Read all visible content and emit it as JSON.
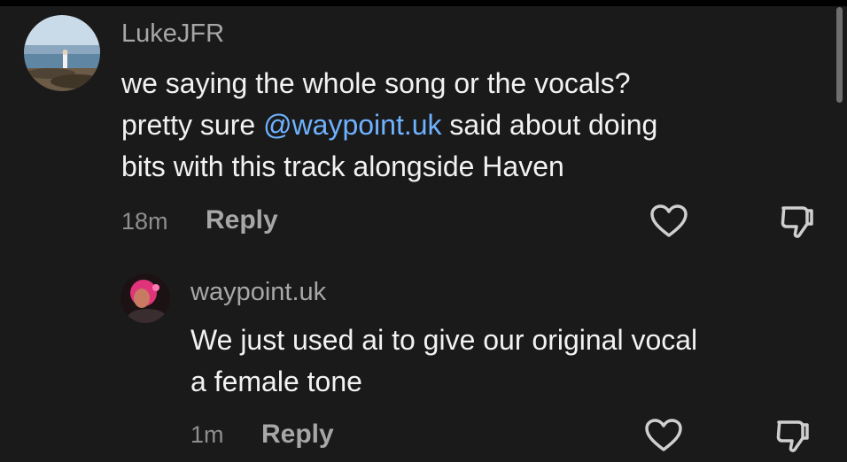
{
  "comments": [
    {
      "username": "LukeJFR",
      "text_line1": "we saying the whole song or the vocals?",
      "text_line2_before": "pretty sure ",
      "text_line2_mention": "@waypoint.uk",
      "text_line2_after": " said about doing",
      "text_line3": "bits with this track alongside Haven",
      "time": "18m",
      "reply_label": "Reply"
    },
    {
      "username": "waypoint.uk",
      "text_line1": "We just used ai to give our original vocal",
      "text_line2": "a female tone",
      "time": "1m",
      "reply_label": "Reply"
    }
  ],
  "icons": {
    "like": "heart-outline-icon",
    "dislike": "thumbs-down-outline-icon"
  },
  "colors": {
    "background": "#1a1a1a",
    "mention": "#6fb2ff",
    "username": "#a7a7a7",
    "meta": "#8e8e8e"
  }
}
